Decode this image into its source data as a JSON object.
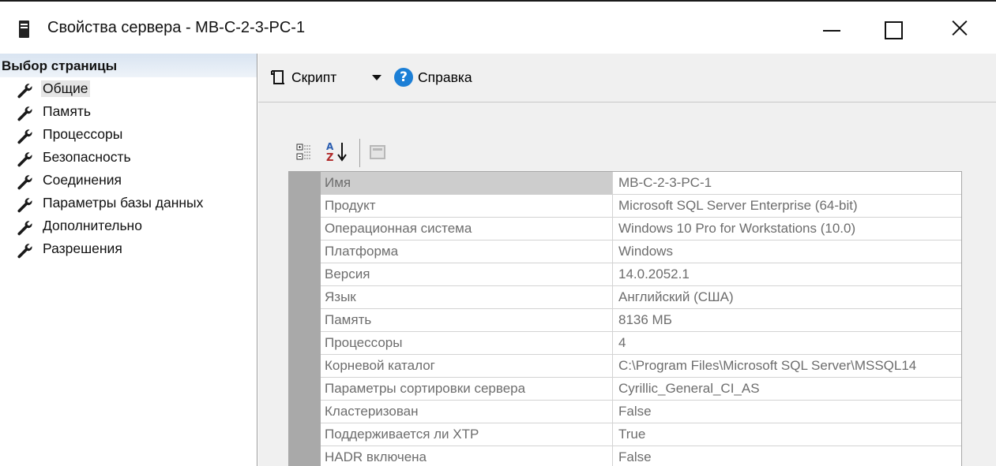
{
  "window": {
    "title": "Свойства сервера - MB-C-2-3-PC-1"
  },
  "sidebar": {
    "header": "Выбор страницы",
    "items": [
      {
        "label": "Общие"
      },
      {
        "label": "Память"
      },
      {
        "label": "Процессоры"
      },
      {
        "label": "Безопасность"
      },
      {
        "label": "Соединения"
      },
      {
        "label": "Параметры базы данных"
      },
      {
        "label": "Дополнительно"
      },
      {
        "label": "Разрешения"
      }
    ],
    "selected_index": 0
  },
  "toolbar": {
    "script_label": "Скрипт",
    "help_label": "Справка"
  },
  "properties": {
    "rows": [
      {
        "name": "Имя",
        "value": "MB-C-2-3-PC-1"
      },
      {
        "name": "Продукт",
        "value": "Microsoft SQL Server Enterprise (64-bit)"
      },
      {
        "name": "Операционная система",
        "value": "Windows 10 Pro for Workstations (10.0)"
      },
      {
        "name": "Платформа",
        "value": "Windows"
      },
      {
        "name": "Версия",
        "value": "14.0.2052.1"
      },
      {
        "name": "Язык",
        "value": "Английский (США)"
      },
      {
        "name": "Память",
        "value": "8136 МБ"
      },
      {
        "name": "Процессоры",
        "value": "4"
      },
      {
        "name": "Корневой каталог",
        "value": "C:\\Program Files\\Microsoft SQL Server\\MSSQL14"
      },
      {
        "name": "Параметры сортировки сервера",
        "value": "Cyrillic_General_CI_AS"
      },
      {
        "name": "Кластеризован",
        "value": "False"
      },
      {
        "name": "Поддерживается ли XTP",
        "value": "True"
      },
      {
        "name": "HADR включена",
        "value": "False"
      }
    ]
  },
  "icons": {
    "app": "server-icon",
    "nav": "wrench-icon",
    "script": "script-icon",
    "dropdown": "chevron-down-icon",
    "help": "help-icon",
    "categorized": "categorized-icon",
    "alphabetical": "sort-az-icon",
    "property_pages": "property-pages-icon"
  },
  "colors": {
    "header_gradient_top": "#d9e4f1",
    "help_icon": "#1c7fd6",
    "grid_margin": "#a9a9a9",
    "selected_row": "#cdcdcd"
  }
}
